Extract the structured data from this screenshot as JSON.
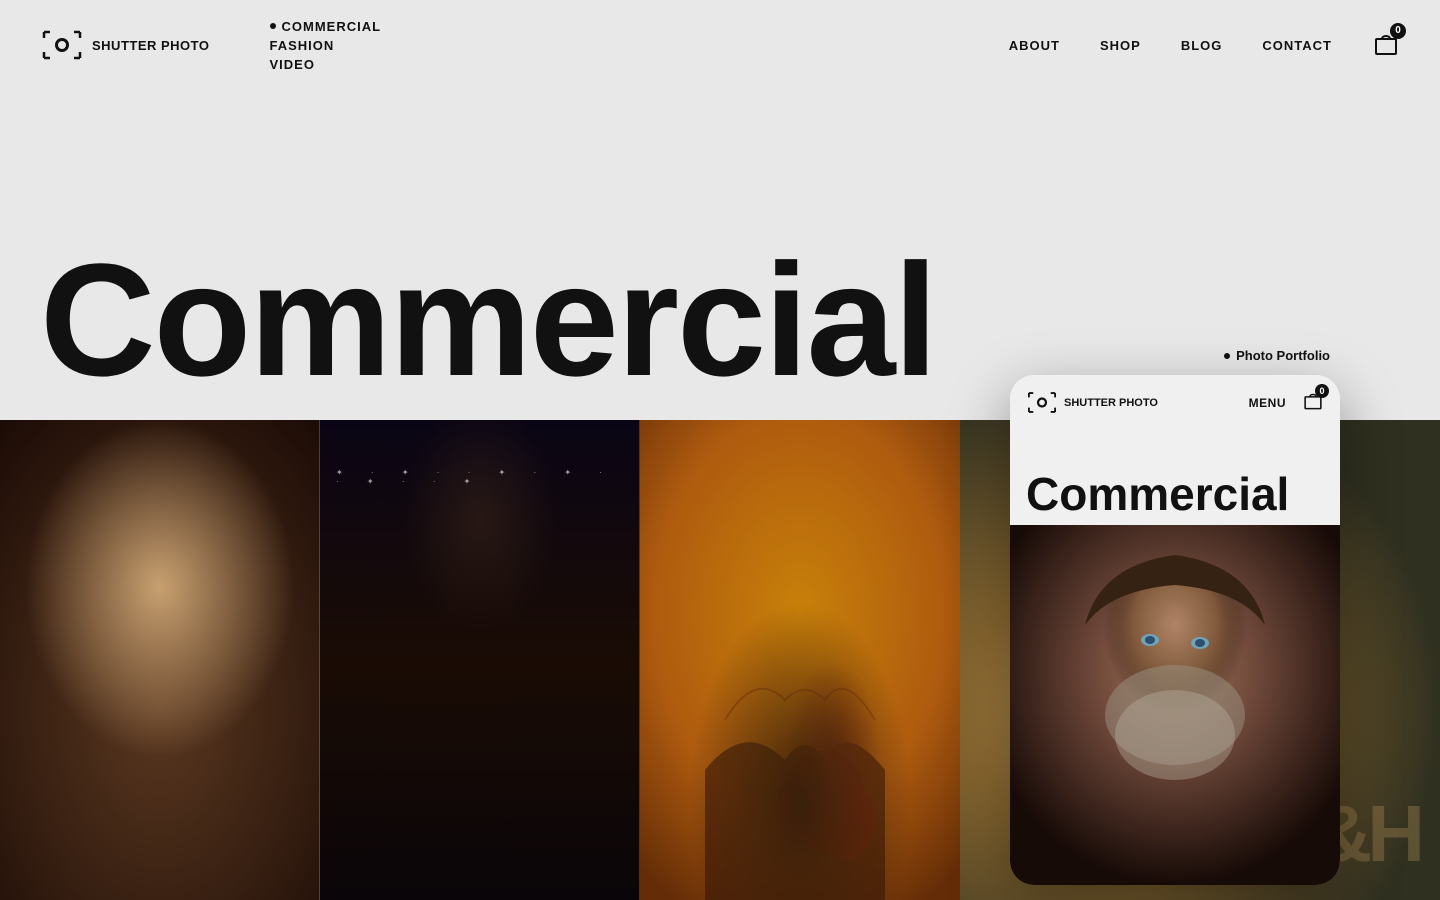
{
  "logo": {
    "text": "SHUTTER PHOTO",
    "mobile_text": "SHUTTER PHOTO"
  },
  "nav_dropdown": {
    "items": [
      {
        "label": "COMMERCIAL",
        "active": true
      },
      {
        "label": "FASHION",
        "active": false
      },
      {
        "label": "VIDEO",
        "active": false
      }
    ]
  },
  "header_nav": {
    "items": [
      {
        "label": "ABOUT"
      },
      {
        "label": "SHOP"
      },
      {
        "label": "BLOG"
      },
      {
        "label": "CONTACT"
      }
    ]
  },
  "cart": {
    "count": "0"
  },
  "hero": {
    "title": "Commercial"
  },
  "photo_portfolio_label": "Photo Portfolio",
  "mobile": {
    "menu_label": "MENU",
    "cart_count": "0",
    "hero_title": "Commercial"
  },
  "watermark": "H&H"
}
